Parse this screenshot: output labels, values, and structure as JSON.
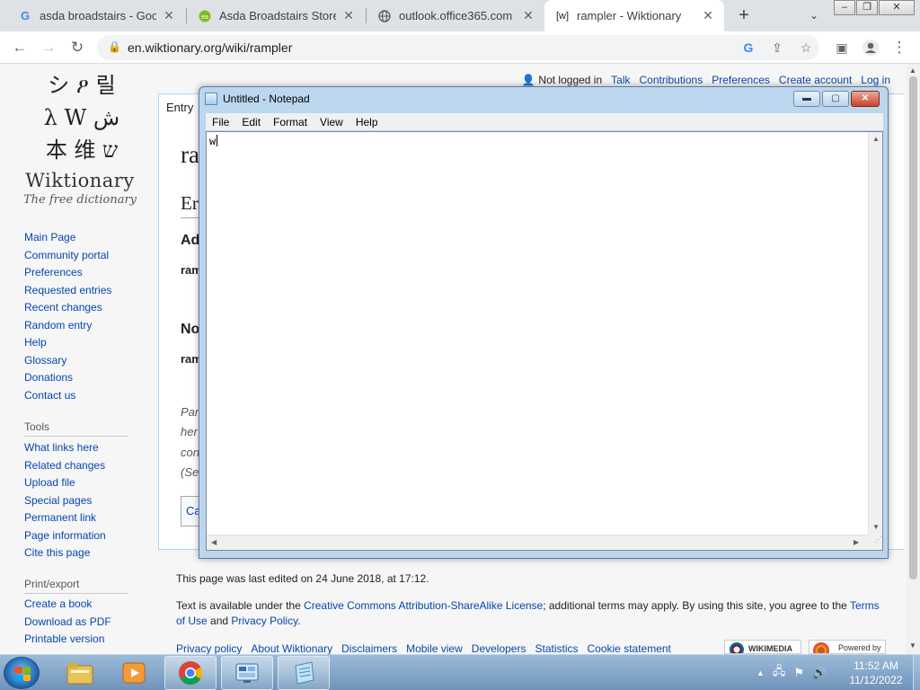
{
  "browser": {
    "tabs": [
      {
        "title": "asda broadstairs - Google",
        "favicon": "G",
        "favicon_color": "#4285f4",
        "active": false
      },
      {
        "title": "Asda Broadstairs Store Co",
        "favicon": "asda-icon",
        "favicon_color": "#78be20",
        "active": false
      },
      {
        "title": "outlook.office365.com",
        "favicon": "globe-icon",
        "favicon_color": "#5f6368",
        "active": false
      },
      {
        "title": "rampler - Wiktionary",
        "favicon": "[w]",
        "favicon_color": "#202124",
        "active": true
      }
    ],
    "close_glyph": "✕",
    "new_tab_glyph": "+",
    "url": "en.wiktionary.org/wiki/rampler"
  },
  "wiki": {
    "logo": {
      "glyph_rows": [
        "シ ዖ 릴",
        "λ W ش",
        "本 维 ש"
      ],
      "name": "Wiktionary",
      "tagline": "The free dictionary"
    },
    "personal": {
      "not_logged_in": "Not logged in",
      "links": [
        "Talk",
        "Contributions",
        "Preferences",
        "Create account",
        "Log in"
      ]
    },
    "nav": [
      "Main Page",
      "Community portal",
      "Preferences",
      "Requested entries",
      "Recent changes",
      "Random entry",
      "Help",
      "Glossary",
      "Donations",
      "Contact us"
    ],
    "tools_heading": "Tools",
    "tools": [
      "What links here",
      "Related changes",
      "Upload file",
      "Special pages",
      "Permanent link",
      "Page information",
      "Cite this page"
    ],
    "print_heading": "Print/export",
    "print": [
      "Create a book",
      "Download as PDF",
      "Printable version"
    ],
    "entry_tab": "Entry",
    "fragments": {
      "title": "ra",
      "lang": "Er",
      "adj_heading": "Ad",
      "adj_word": "ram",
      "noun_heading": "No",
      "noun_word": "ram",
      "para1": "Par",
      "para2": "her",
      "para3": "con",
      "para4": "(Se",
      "cat": "Ca"
    },
    "footer": {
      "last_edited": "This page was last edited on 24 June 2018, at 17:12.",
      "license_pre": "Text is available under the ",
      "license_link": "Creative Commons Attribution-ShareAlike License",
      "license_mid": "; additional terms may apply. By using this site, you agree to the ",
      "terms_link": "Terms of Use",
      "and": " and ",
      "privacy_link": "Privacy Policy",
      "period": ".",
      "links": [
        "Privacy policy",
        "About Wiktionary",
        "Disclaimers",
        "Mobile view",
        "Developers",
        "Statistics",
        "Cookie statement"
      ],
      "badge_wikimedia": "WIKIMEDIA",
      "badge_powered": "Powered by"
    }
  },
  "notepad": {
    "title": "Untitled - Notepad",
    "menu": [
      "File",
      "Edit",
      "Format",
      "View",
      "Help"
    ],
    "text": "w"
  },
  "taskbar": {
    "time": "11:52 AM",
    "date": "11/12/2022"
  }
}
